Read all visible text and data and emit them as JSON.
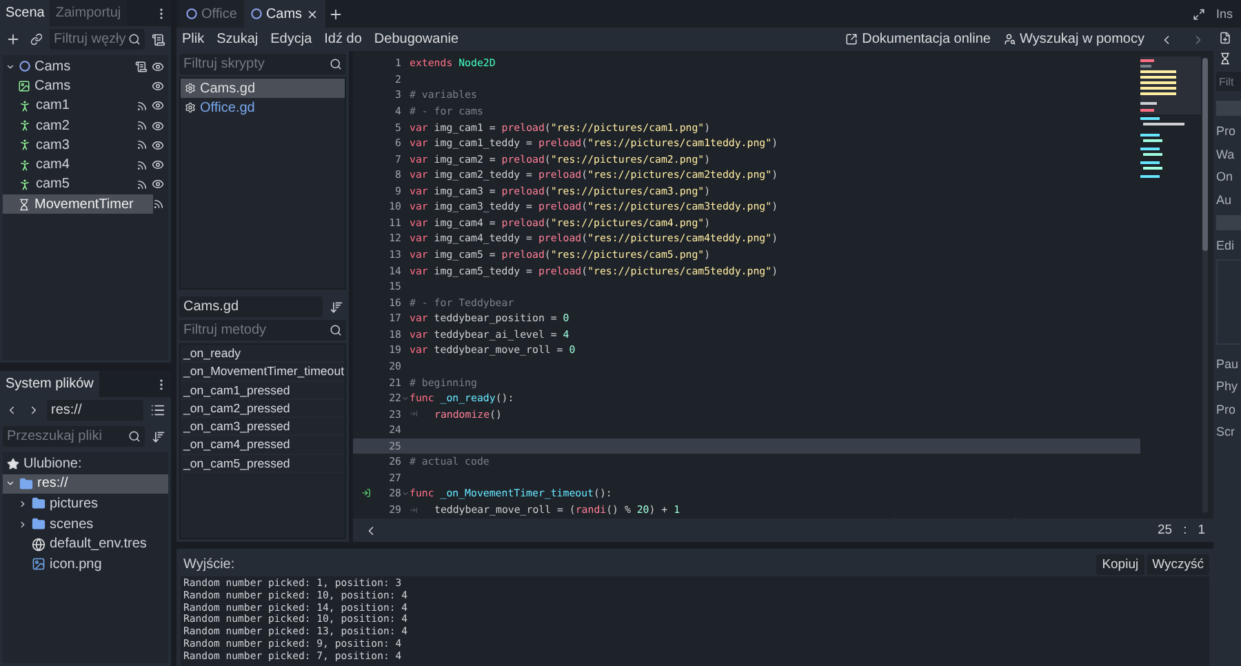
{
  "scene_dock": {
    "tabs": [
      {
        "label": "Scena",
        "selected": true
      },
      {
        "label": "Zaimportuj",
        "selected": false
      }
    ],
    "filter": {
      "placeholder": "Filtruj węzły"
    },
    "nodes": [
      {
        "name": "Cams",
        "kind": "node2d",
        "script": true,
        "visible": true,
        "expanded": true,
        "selected": false,
        "children": [
          {
            "name": "Cams",
            "kind": "sprite",
            "visible": true,
            "selected": false
          },
          {
            "name": "cam1",
            "kind": "button",
            "signals": true,
            "visible": true,
            "selected": false
          },
          {
            "name": "cam2",
            "kind": "button",
            "signals": true,
            "visible": true,
            "selected": false
          },
          {
            "name": "cam3",
            "kind": "button",
            "signals": true,
            "visible": true,
            "selected": false
          },
          {
            "name": "cam4",
            "kind": "button",
            "signals": true,
            "visible": true,
            "selected": false
          },
          {
            "name": "cam5",
            "kind": "button",
            "signals": true,
            "visible": true,
            "selected": false
          },
          {
            "name": "MovementTimer",
            "kind": "timer",
            "signals": true,
            "selected": true
          }
        ]
      }
    ]
  },
  "filesystem_dock": {
    "tabs": [
      {
        "label": "System plików",
        "selected": true
      }
    ],
    "path": "res://",
    "search": {
      "placeholder": "Przeszukaj pliki"
    },
    "favorites": "Ulubione:",
    "items": [
      {
        "name": "res://",
        "kind": "folder",
        "expanded": true,
        "selected": true,
        "children": [
          {
            "name": "pictures",
            "kind": "folder",
            "expanded": false,
            "selected": false
          },
          {
            "name": "scenes",
            "kind": "folder",
            "expanded": false,
            "selected": false
          },
          {
            "name": "default_env.tres",
            "kind": "environment",
            "selected": false
          },
          {
            "name": "icon.png",
            "kind": "image",
            "selected": false
          }
        ]
      }
    ]
  },
  "script_tabs": [
    {
      "label": "Office",
      "selected": false
    },
    {
      "label": "Cams",
      "selected": true
    }
  ],
  "menu": [
    "Plik",
    "Szukaj",
    "Edycja",
    "Idź do",
    "Debugowanie"
  ],
  "help_buttons": [
    {
      "label": "Dokumentacja online",
      "kind": "docs"
    },
    {
      "label": "Wyszukaj w pomocy",
      "kind": "search"
    }
  ],
  "scripts": {
    "filter": {
      "placeholder": "Filtruj skrypty"
    },
    "items": [
      {
        "name": "Cams.gd",
        "selected": true,
        "color": "#e0e0e0"
      },
      {
        "name": "Office.gd",
        "selected": false,
        "color": "#7aa8ee"
      }
    ],
    "current": "Cams.gd",
    "method_filter": {
      "placeholder": "Filtruj metody"
    },
    "methods": [
      "_on_ready",
      "_on_MovementTimer_timeout",
      "_on_cam1_pressed",
      "_on_cam2_pressed",
      "_on_cam3_pressed",
      "_on_cam4_pressed",
      "_on_cam5_pressed"
    ]
  },
  "editor": {
    "lines": [
      {
        "number": "1",
        "fold": false,
        "signal": false,
        "current": false,
        "tokens": [
          {
            "kind": "keyword",
            "text": "extends"
          },
          {
            "kind": "type",
            "text": " Node2D"
          }
        ]
      },
      {
        "number": "2",
        "fold": false,
        "signal": false,
        "current": false
      },
      {
        "number": "3",
        "fold": false,
        "signal": false,
        "current": false,
        "tokens": [
          {
            "kind": "comment",
            "text": "# variables"
          }
        ]
      },
      {
        "number": "4",
        "fold": false,
        "signal": false,
        "current": false,
        "tokens": [
          {
            "kind": "comment",
            "text": "# - for cams"
          }
        ]
      },
      {
        "number": "5",
        "fold": false,
        "signal": false,
        "current": false,
        "tokens": [
          {
            "kind": "keyword",
            "text": "var"
          },
          {
            "kind": "plain",
            "text": " img_cam1 = "
          },
          {
            "kind": "call",
            "text": "preload"
          },
          {
            "kind": "plain",
            "text": "("
          },
          {
            "kind": "string",
            "text": "\"res://pictures/cam1.png\""
          },
          {
            "kind": "plain",
            "text": ")"
          }
        ]
      },
      {
        "number": "6",
        "fold": false,
        "signal": false,
        "current": false,
        "tokens": [
          {
            "kind": "keyword",
            "text": "var"
          },
          {
            "kind": "plain",
            "text": " img_cam1_teddy = "
          },
          {
            "kind": "call",
            "text": "preload"
          },
          {
            "kind": "plain",
            "text": "("
          },
          {
            "kind": "string",
            "text": "\"res://pictures/cam1teddy.png\""
          },
          {
            "kind": "plain",
            "text": ")"
          }
        ]
      },
      {
        "number": "7",
        "fold": false,
        "signal": false,
        "current": false,
        "tokens": [
          {
            "kind": "keyword",
            "text": "var"
          },
          {
            "kind": "plain",
            "text": " img_cam2 = "
          },
          {
            "kind": "call",
            "text": "preload"
          },
          {
            "kind": "plain",
            "text": "("
          },
          {
            "kind": "string",
            "text": "\"res://pictures/cam2.png\""
          },
          {
            "kind": "plain",
            "text": ")"
          }
        ]
      },
      {
        "number": "8",
        "fold": false,
        "signal": false,
        "current": false,
        "tokens": [
          {
            "kind": "keyword",
            "text": "var"
          },
          {
            "kind": "plain",
            "text": " img_cam2_teddy = "
          },
          {
            "kind": "call",
            "text": "preload"
          },
          {
            "kind": "plain",
            "text": "("
          },
          {
            "kind": "string",
            "text": "\"res://pictures/cam2teddy.png\""
          },
          {
            "kind": "plain",
            "text": ")"
          }
        ]
      },
      {
        "number": "9",
        "fold": false,
        "signal": false,
        "current": false,
        "tokens": [
          {
            "kind": "keyword",
            "text": "var"
          },
          {
            "kind": "plain",
            "text": " img_cam3 = "
          },
          {
            "kind": "call",
            "text": "preload"
          },
          {
            "kind": "plain",
            "text": "("
          },
          {
            "kind": "string",
            "text": "\"res://pictures/cam3.png\""
          },
          {
            "kind": "plain",
            "text": ")"
          }
        ]
      },
      {
        "number": "10",
        "fold": false,
        "signal": false,
        "current": false,
        "tokens": [
          {
            "kind": "keyword",
            "text": "var"
          },
          {
            "kind": "plain",
            "text": " img_cam3_teddy = "
          },
          {
            "kind": "call",
            "text": "preload"
          },
          {
            "kind": "plain",
            "text": "("
          },
          {
            "kind": "string",
            "text": "\"res://pictures/cam3teddy.png\""
          },
          {
            "kind": "plain",
            "text": ")"
          }
        ]
      },
      {
        "number": "11",
        "fold": false,
        "signal": false,
        "current": false,
        "tokens": [
          {
            "kind": "keyword",
            "text": "var"
          },
          {
            "kind": "plain",
            "text": " img_cam4 = "
          },
          {
            "kind": "call",
            "text": "preload"
          },
          {
            "kind": "plain",
            "text": "("
          },
          {
            "kind": "string",
            "text": "\"res://pictures/cam4.png\""
          },
          {
            "kind": "plain",
            "text": ")"
          }
        ]
      },
      {
        "number": "12",
        "fold": false,
        "signal": false,
        "current": false,
        "tokens": [
          {
            "kind": "keyword",
            "text": "var"
          },
          {
            "kind": "plain",
            "text": " img_cam4_teddy = "
          },
          {
            "kind": "call",
            "text": "preload"
          },
          {
            "kind": "plain",
            "text": "("
          },
          {
            "kind": "string",
            "text": "\"res://pictures/cam4teddy.png\""
          },
          {
            "kind": "plain",
            "text": ")"
          }
        ]
      },
      {
        "number": "13",
        "fold": false,
        "signal": false,
        "current": false,
        "tokens": [
          {
            "kind": "keyword",
            "text": "var"
          },
          {
            "kind": "plain",
            "text": " img_cam5 = "
          },
          {
            "kind": "call",
            "text": "preload"
          },
          {
            "kind": "plain",
            "text": "("
          },
          {
            "kind": "string",
            "text": "\"res://pictures/cam5.png\""
          },
          {
            "kind": "plain",
            "text": ")"
          }
        ]
      },
      {
        "number": "14",
        "fold": false,
        "signal": false,
        "current": false,
        "tokens": [
          {
            "kind": "keyword",
            "text": "var"
          },
          {
            "kind": "plain",
            "text": " img_cam5_teddy = "
          },
          {
            "kind": "call",
            "text": "preload"
          },
          {
            "kind": "plain",
            "text": "("
          },
          {
            "kind": "string",
            "text": "\"res://pictures/cam5teddy.png\""
          },
          {
            "kind": "plain",
            "text": ")"
          }
        ]
      },
      {
        "number": "15",
        "fold": false,
        "signal": false,
        "current": false
      },
      {
        "number": "16",
        "fold": false,
        "signal": false,
        "current": false,
        "tokens": [
          {
            "kind": "comment",
            "text": "# - for Teddybear"
          }
        ]
      },
      {
        "number": "17",
        "fold": false,
        "signal": false,
        "current": false,
        "tokens": [
          {
            "kind": "keyword",
            "text": "var"
          },
          {
            "kind": "plain",
            "text": " teddybear_position = "
          },
          {
            "kind": "number",
            "text": "0"
          }
        ]
      },
      {
        "number": "18",
        "fold": false,
        "signal": false,
        "current": false,
        "tokens": [
          {
            "kind": "keyword",
            "text": "var"
          },
          {
            "kind": "plain",
            "text": " teddybear_ai_level = "
          },
          {
            "kind": "number",
            "text": "4"
          }
        ]
      },
      {
        "number": "19",
        "fold": false,
        "signal": false,
        "current": false,
        "tokens": [
          {
            "kind": "keyword",
            "text": "var"
          },
          {
            "kind": "plain",
            "text": " teddybear_move_roll = "
          },
          {
            "kind": "number",
            "text": "0"
          }
        ]
      },
      {
        "number": "20",
        "fold": false,
        "signal": false,
        "current": false
      },
      {
        "number": "21",
        "fold": false,
        "signal": false,
        "current": false,
        "tokens": [
          {
            "kind": "comment",
            "text": "# beginning"
          }
        ]
      },
      {
        "number": "22",
        "fold": true,
        "signal": false,
        "current": false,
        "tokens": [
          {
            "kind": "keyword",
            "text": "func"
          },
          {
            "kind": "function",
            "text": " _on_ready"
          },
          {
            "kind": "plain",
            "text": "():"
          }
        ]
      },
      {
        "number": "23",
        "fold": false,
        "signal": false,
        "current": false,
        "tokens": [
          {
            "kind": "tab"
          },
          {
            "kind": "call",
            "text": "randomize"
          },
          {
            "kind": "plain",
            "text": "()"
          }
        ]
      },
      {
        "number": "24",
        "fold": false,
        "signal": false,
        "current": false
      },
      {
        "number": "25",
        "fold": false,
        "signal": false,
        "current": true
      },
      {
        "number": "26",
        "fold": false,
        "signal": false,
        "current": false,
        "tokens": [
          {
            "kind": "comment",
            "text": "# actual code"
          }
        ]
      },
      {
        "number": "27",
        "fold": false,
        "signal": false,
        "current": false
      },
      {
        "number": "28",
        "fold": true,
        "signal": true,
        "current": false,
        "tokens": [
          {
            "kind": "keyword",
            "text": "func"
          },
          {
            "kind": "function",
            "text": " _on_MovementTimer_timeout"
          },
          {
            "kind": "plain",
            "text": "():"
          }
        ]
      },
      {
        "number": "29",
        "fold": false,
        "signal": false,
        "current": false,
        "tokens": [
          {
            "kind": "tab"
          },
          {
            "kind": "plain",
            "text": "teddybear_move_roll = ("
          },
          {
            "kind": "call",
            "text": "randi"
          },
          {
            "kind": "plain",
            "text": "() % "
          },
          {
            "kind": "number",
            "text": "20"
          },
          {
            "kind": "plain",
            "text": ") + "
          },
          {
            "kind": "number",
            "text": "1"
          }
        ]
      }
    ],
    "status": {
      "line": "25",
      "separator": ":",
      "column": "1"
    }
  },
  "output": {
    "title": "Wyjście:",
    "buttons": [
      "Kopiuj",
      "Wyczyść"
    ],
    "lines": [
      "Random number picked: 1, position: 3",
      "Random number picked: 10, position: 4",
      "Random number picked: 14, position: 4",
      "Random number picked: 10, position: 4",
      "Random number picked: 13, position: 4",
      "Random number picked: 9, position: 4",
      "Random number picked: 7, position: 4"
    ]
  },
  "inspector": {
    "title": "Ins",
    "filter": {
      "placeholder": "Filt"
    },
    "rows": [
      {
        "kind": "section"
      },
      {
        "kind": "property",
        "label": "Pro"
      },
      {
        "kind": "property",
        "label": "Wa"
      },
      {
        "kind": "property",
        "label": "On"
      },
      {
        "kind": "property",
        "label": "Au"
      },
      {
        "kind": "section"
      },
      {
        "kind": "property",
        "label": "Edi"
      },
      {
        "kind": "area"
      },
      {
        "kind": "property",
        "label": "Pau"
      },
      {
        "kind": "property",
        "label": "Phy"
      },
      {
        "kind": "property",
        "label": "Pro"
      },
      {
        "kind": "property",
        "label": "Scr"
      }
    ]
  }
}
